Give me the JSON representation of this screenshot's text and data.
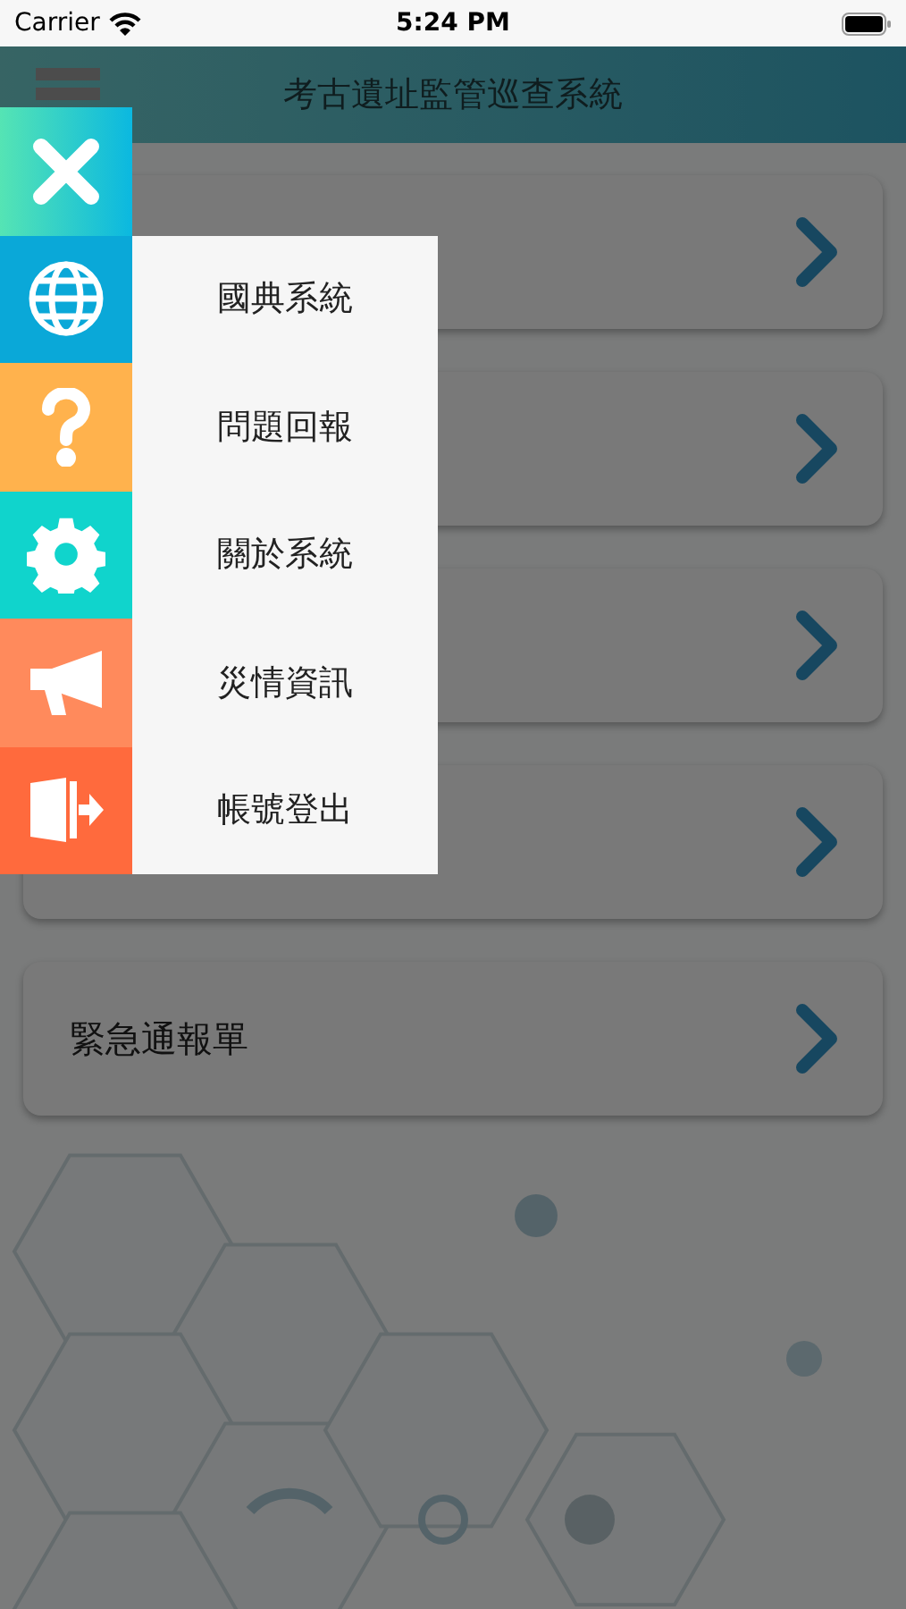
{
  "status_bar": {
    "carrier": "Carrier",
    "time": "5:24 PM"
  },
  "header": {
    "title": "考古遺址監管巡查系統"
  },
  "cards": [
    {
      "kind": "covered"
    },
    {
      "kind": "covered"
    },
    {
      "kind": "covered"
    },
    {
      "kind": "covered"
    },
    {
      "kind": "labeled",
      "label": "緊急通報單"
    }
  ],
  "menu": {
    "open": true,
    "items": [
      {
        "kind": "globe",
        "label": "國典系統",
        "color": "#0aa8d8"
      },
      {
        "kind": "question",
        "label": "問題回報",
        "color": "#ffb24d"
      },
      {
        "kind": "gear",
        "label": "關於系統",
        "color": "#10d4cc"
      },
      {
        "kind": "megaphone",
        "label": "災情資訊",
        "color": "#ff8a5c"
      },
      {
        "kind": "exit",
        "label": "帳號登出",
        "color": "#ff6a3d"
      }
    ]
  }
}
